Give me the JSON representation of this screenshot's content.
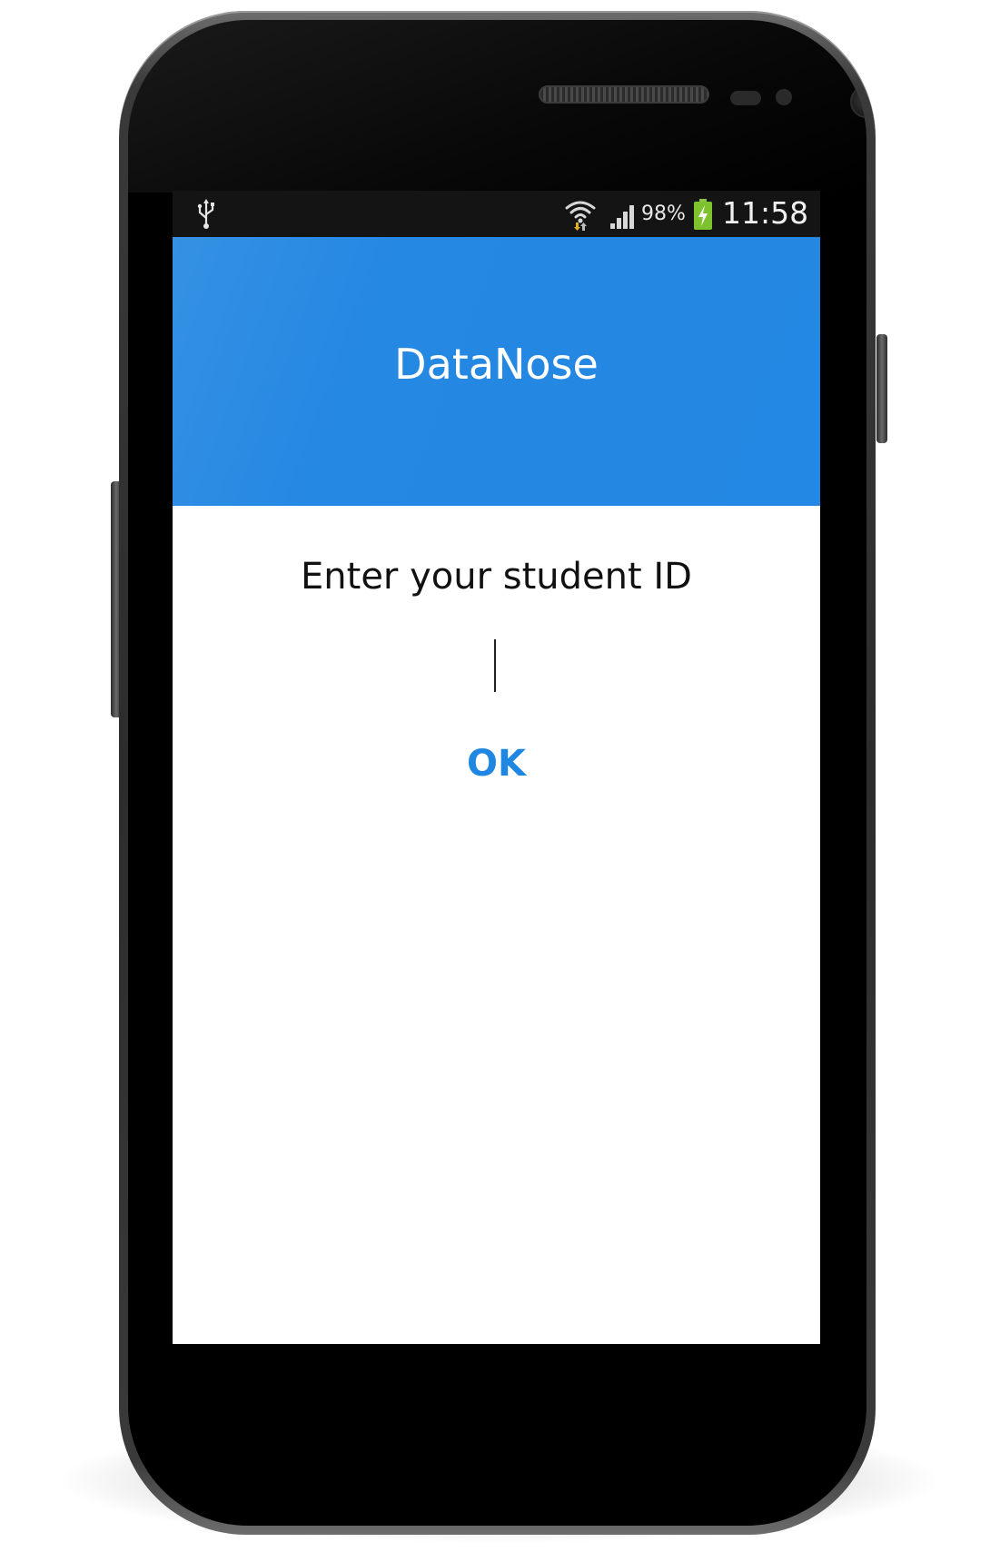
{
  "status_bar": {
    "battery_percent": "98%",
    "time": "11:58",
    "icons": [
      "usb-icon",
      "wifi-icon",
      "cell-signal-icon",
      "battery-charging-icon"
    ]
  },
  "app_bar": {
    "title": "DataNose",
    "color": "#2388E3"
  },
  "form": {
    "prompt": "Enter your student ID",
    "input_value": "",
    "ok_label": "OK",
    "ok_color": "#1F87E2"
  }
}
